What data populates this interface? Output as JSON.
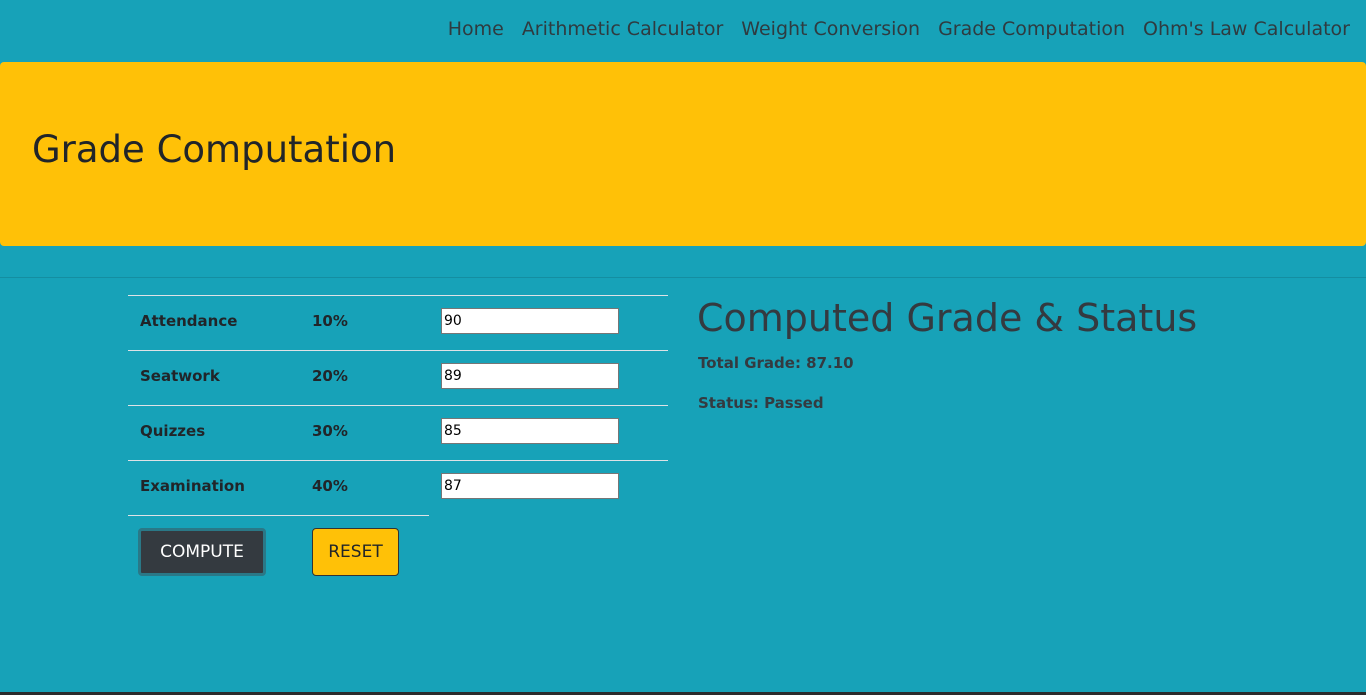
{
  "nav": {
    "links": [
      "Home",
      "Arithmetic Calculator",
      "Weight Conversion",
      "Grade Computation",
      "Ohm's Law Calculator"
    ]
  },
  "banner": {
    "title": "Grade Computation"
  },
  "form": {
    "rows": [
      {
        "label": "Attendance",
        "weight": "10%",
        "value": "90"
      },
      {
        "label": "Seatwork",
        "weight": "20%",
        "value": "89"
      },
      {
        "label": "Quizzes",
        "weight": "30%",
        "value": "85"
      },
      {
        "label": "Examination",
        "weight": "40%",
        "value": "87"
      }
    ],
    "compute_label": "COMPUTE",
    "reset_label": "RESET"
  },
  "result": {
    "title": "Computed Grade & Status",
    "total": "Total Grade: 87.10",
    "status": "Status: Passed"
  },
  "colors": {
    "page_bg": "#17a2b8",
    "banner_bg": "#ffc107",
    "compute_bg": "#343a40",
    "reset_bg": "#ffc107"
  }
}
